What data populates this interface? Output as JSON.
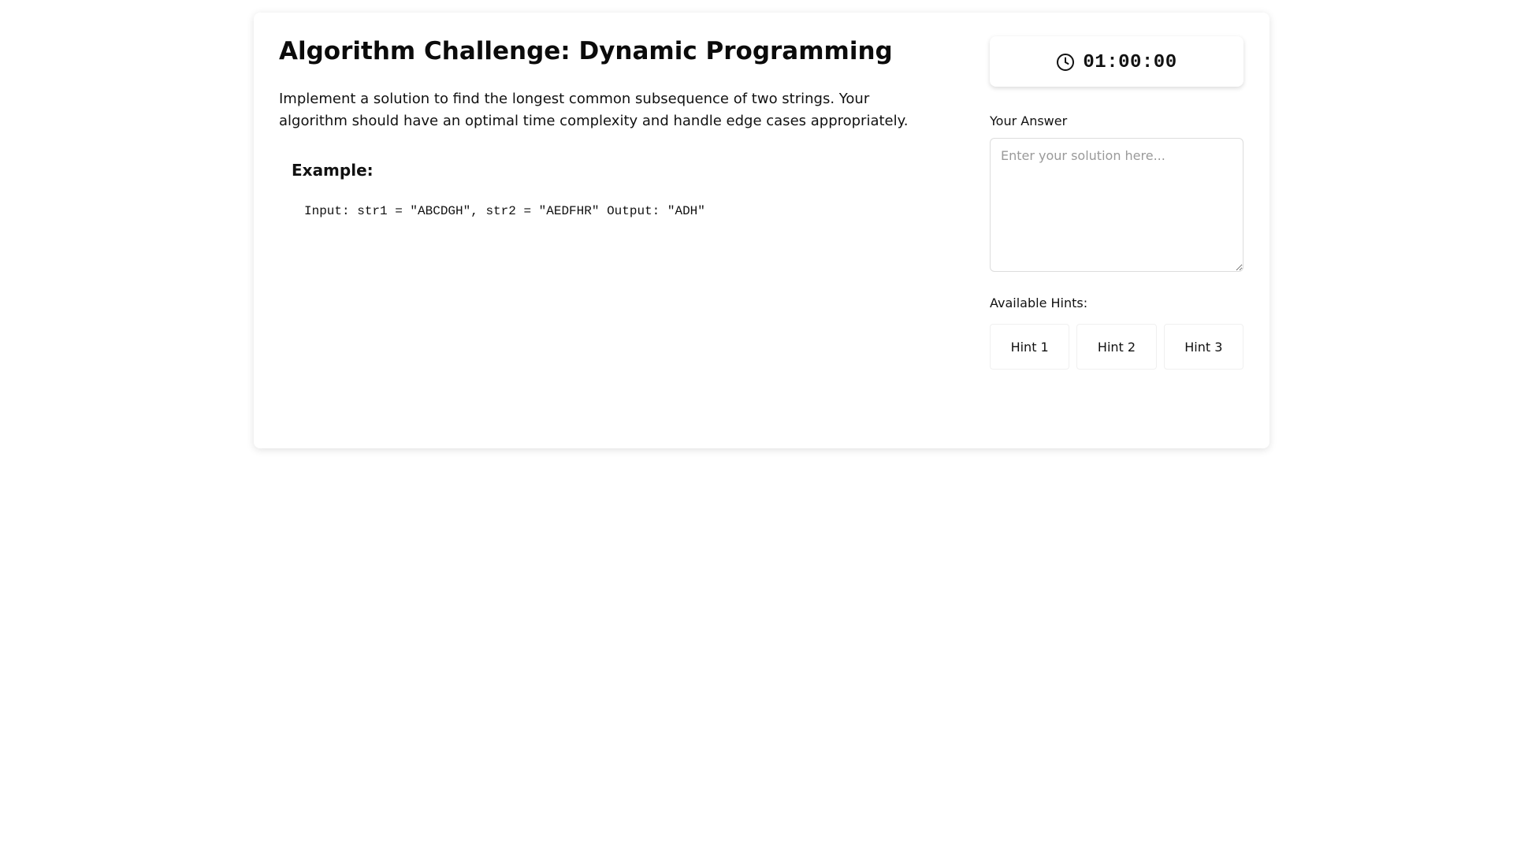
{
  "challenge": {
    "title": "Algorithm Challenge: Dynamic Programming",
    "description": "Implement a solution to find the longest common subsequence of two strings. Your algorithm should have an optimal time complexity and handle edge cases appropriately.",
    "example_heading": "Example:",
    "example_code": "Input: str1 = \"ABCDGH\", str2 = \"AEDFHR\" Output: \"ADH\""
  },
  "timer": {
    "icon": "clock-icon",
    "value": "01:00:00"
  },
  "answer": {
    "label": "Your Answer",
    "placeholder": "Enter your solution here...",
    "value": ""
  },
  "hints": {
    "label": "Available Hints:",
    "buttons": [
      {
        "label": "Hint 1"
      },
      {
        "label": "Hint 2"
      },
      {
        "label": "Hint 3"
      }
    ]
  }
}
